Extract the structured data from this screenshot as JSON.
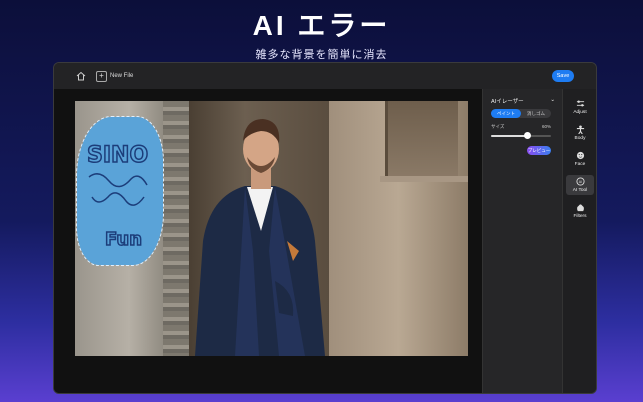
{
  "headline": {
    "title": "AI エラー",
    "subtitle": "雑多な背景を簡単に消去"
  },
  "topbar": {
    "new_file_label": "New File",
    "save_label": "Save"
  },
  "panel": {
    "title": "AIイレーザー",
    "tabs": [
      {
        "label": "ペイント",
        "active": true
      },
      {
        "label": "消しゴム",
        "active": false
      }
    ],
    "size_label": "サイズ",
    "size_value": "60%",
    "size_fraction": 0.6,
    "preview_label": "プレビュー"
  },
  "toolbar": {
    "items": [
      {
        "label": "Adjust",
        "icon": "sliders-icon"
      },
      {
        "label": "Body",
        "icon": "body-icon"
      },
      {
        "label": "Face",
        "icon": "face-icon"
      },
      {
        "label": "AI Tool",
        "icon": "ai-tool-icon",
        "active": true
      },
      {
        "label": "Filters",
        "icon": "filters-icon"
      }
    ]
  },
  "graffiti_text": [
    "SINO",
    "Fun"
  ],
  "colors": {
    "accent": "#1e7cf2",
    "background": "#141a5e",
    "app": "#1c1c1e"
  }
}
